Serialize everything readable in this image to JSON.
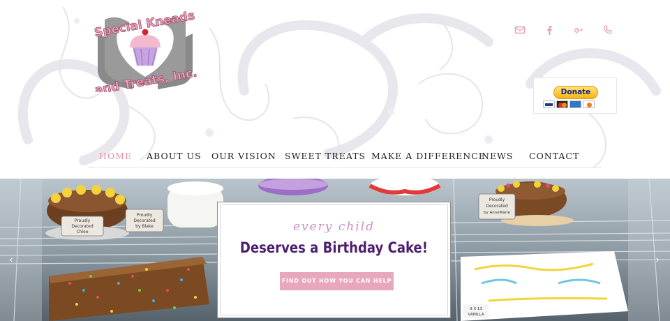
{
  "logo": {
    "line1": "Special Kneads",
    "line2": "and Treats, Inc."
  },
  "social": [
    {
      "icon": "envelope-icon",
      "color": "#eaa0b6"
    },
    {
      "icon": "facebook-icon",
      "color": "#eaa0b6"
    },
    {
      "icon": "google-plus-icon",
      "color": "#eaa0b6"
    },
    {
      "icon": "phone-icon",
      "color": "#eaa0b6"
    }
  ],
  "donate": {
    "label": "Donate",
    "cards": [
      "visa",
      "mastercard",
      "amex",
      "discover"
    ]
  },
  "nav": {
    "items": [
      {
        "label": "HOME",
        "active": true
      },
      {
        "label": "ABOUT US",
        "active": false
      },
      {
        "label": "OUR VISION",
        "active": false
      },
      {
        "label": "SWEET TREATS",
        "active": false
      },
      {
        "label": "MAKE A DIFFERENCE",
        "active": false
      },
      {
        "label": "NEWS",
        "active": false
      },
      {
        "label": "CONTACT",
        "active": false
      }
    ],
    "active_color": "#e58fa9"
  },
  "hero": {
    "prev_arrow": "‹",
    "next_arrow": "›",
    "signs": {
      "left": [
        "Proudly",
        "Decorated",
        "Chloe"
      ],
      "mid": [
        "Proudly",
        "Decorated",
        "by Blake"
      ],
      "right": [
        "Proudly",
        "Decorated",
        "by AnneMarie"
      ]
    },
    "cake_label": [
      "9 X 13",
      "VANILLA"
    ],
    "caption": {
      "subtitle": "every child",
      "title": "Deserves a Birthday Cake!",
      "button": "FIND OUT HOW YOU CAN HELP"
    }
  },
  "colors": {
    "accent_pink": "#e8a7bd",
    "title_purple": "#4b1f6f",
    "subtitle_lilac": "#c98fc9"
  }
}
